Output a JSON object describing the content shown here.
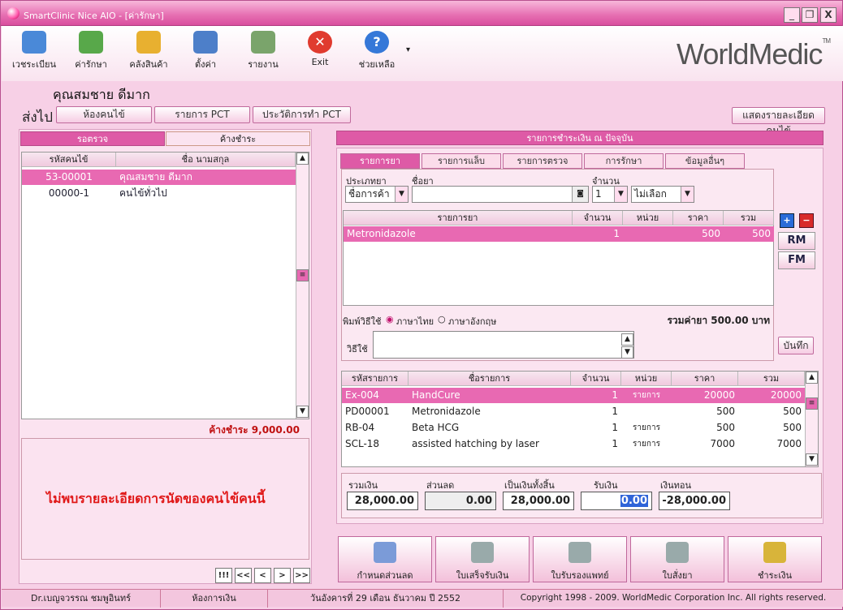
{
  "window": {
    "title": "SmartClinic Nice AIO - [ค่ารักษา]",
    "min": "_",
    "max": "❐",
    "close": "X"
  },
  "toolbar": {
    "items": [
      {
        "label": "เวชระเบียน",
        "color": "#4a89d8"
      },
      {
        "label": "ค่ารักษา",
        "color": "#58a84a"
      },
      {
        "label": "คลังสินค้า",
        "color": "#e8b030"
      },
      {
        "label": "ตั้งค่า",
        "color": "#4d7fc9"
      },
      {
        "label": "รายงาน",
        "color": "#7aa46b"
      },
      {
        "label": "Exit",
        "color": "#e03b2f"
      },
      {
        "label": "ช่วยเหลือ",
        "color": "#3578d8"
      }
    ],
    "more": "▾",
    "logo": "WorldMedic",
    "logo_tm": "TM"
  },
  "patient_name": "คุณสมชาย ดีมาก",
  "sendbar": {
    "label": "ส่งไป",
    "buttons": [
      "ห้องคนไข้",
      "รายการ PCT",
      "ประวัติการทำ PCT"
    ],
    "right_button": "แสดงรายละเอียดคนไข้"
  },
  "left": {
    "tabs": [
      "รอตรวจ",
      "ค้างชำระ"
    ],
    "columns": [
      "รหัสคนไข้",
      "ชื่อ นามสกุล"
    ],
    "rows": [
      [
        "53-00001",
        "คุณสมชาย ดีมาก"
      ],
      [
        "00000-1",
        "คนไข้ทั่วไป"
      ]
    ],
    "outstanding": "ค้างชำระ  9,000.00",
    "no_appt": "ไม่พบรายละเอียดการนัดของคนไข้คนนี้",
    "nav": [
      "!!!",
      "<<",
      "<",
      ">",
      ">>"
    ]
  },
  "right": {
    "header": "รายการชำระเงิน ณ ปัจจุบัน",
    "tabs": [
      "รายการยา",
      "รายการแล็บ",
      "รายการตรวจวินิจฉัย",
      "การรักษา",
      "ข้อมูลอื่นๆ"
    ],
    "form": {
      "type_label": "ประเภทยา",
      "type_value": "ชื่อการค้า",
      "drug_label": "ชื่อยา",
      "drug_value": "",
      "qty_label": "จำนวน",
      "qty_value": "1",
      "opt_value": "ไม่เลือก"
    },
    "drug_columns": [
      "รายการยา",
      "จำนวน",
      "หน่วย",
      "ราคา",
      "รวม"
    ],
    "drug_rows": [
      [
        "Metronidazole",
        "1",
        "",
        "500",
        "500"
      ]
    ],
    "print_label": "พิมพ์วิธีใช้",
    "lang_thai": "ภาษาไทย",
    "lang_eng": "ภาษาอังกฤษ",
    "drug_total": "รวมค่ายา 500.00 บาท",
    "usage_label": "วิธีใช้",
    "save": "บันทึก",
    "side": {
      "add": "+",
      "del": "−",
      "rm": "RM",
      "fm": "FM"
    },
    "item_columns": [
      "รหัสรายการ",
      "ชื่อรายการ",
      "จำนวน",
      "หน่วย",
      "ราคา",
      "รวม"
    ],
    "item_rows": [
      [
        "Ex-004",
        "HandCure",
        "1",
        "รายการ",
        "20000",
        "20000"
      ],
      [
        "PD00001",
        "Metronidazole",
        "1",
        "",
        "500",
        "500"
      ],
      [
        "RB-04",
        "Beta HCG",
        "1",
        "รายการ",
        "500",
        "500"
      ],
      [
        "SCL-18",
        "assisted hatching by laser",
        "1",
        "รายการ",
        "7000",
        "7000"
      ]
    ],
    "totals": {
      "sum_label": "รวมเงิน",
      "sum": "28,000.00",
      "disc_label": "ส่วนลด",
      "disc": "0.00",
      "net_label": "เป็นเงินทั้งสิ้น",
      "net": "28,000.00",
      "recv_label": "รับเงิน",
      "recv": "0.00",
      "change_label": "เงินทอน",
      "change": "-28,000.00"
    },
    "actions": [
      "กำหนดส่วนลด",
      "ใบเสร็จรับเงิน",
      "ใบรับรองแพทย์",
      "ใบสั่งยา",
      "ชำระเงิน"
    ]
  },
  "status": [
    "Dr.เบญจวรรณ ชมพูอินทร์",
    "ห้องการเงิน",
    "วันอังคารที่ 29  เดือน ธันวาคม  ปี 2552",
    "Copyright 1998 - 2009. WorldMedic Corporation Inc. All rights reserved."
  ]
}
